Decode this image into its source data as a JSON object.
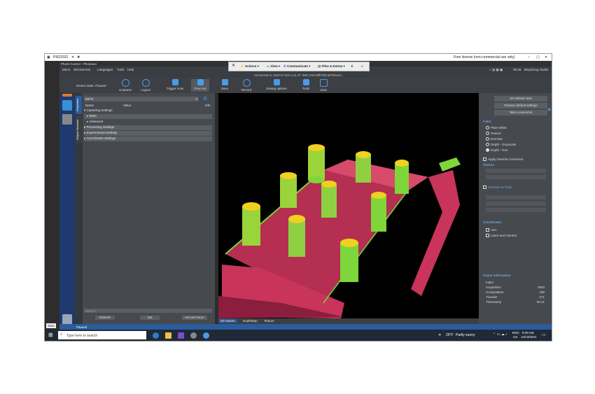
{
  "remote": {
    "session_id": "PI622931",
    "license": "Free license (non-commercial use only)",
    "toolbar": {
      "actions": "Actions",
      "view": "View",
      "communicate": "Communicate",
      "files": "Files & Extras"
    }
  },
  "app": {
    "title": "PhoXi Control - Photoneo",
    "menu": [
      "Menu",
      "3DCameras",
      "Languages",
      "Tools",
      "Help"
    ],
    "connected": "Connected to: 2019-07-021-LC3, IP: fe80::204:4bff:fe05:a078%eno...",
    "device_state": "Device state:  Paused",
    "toolbar": [
      "Unpause",
      "Logout",
      "Trigger scan",
      "Free run",
      "Save",
      "Record",
      "Saving options",
      "Tools",
      "View"
    ],
    "top_right": {
      "time": "09:28",
      "user": "Binpicking Studio"
    }
  },
  "left_tabs": [
    "Properties",
    "Output Structure"
  ],
  "left_panel": {
    "device": "59/70",
    "col_name": "Name",
    "col_value": "Value",
    "col_info": "Info",
    "rows": [
      {
        "label": "Capturing Settings",
        "group": false
      },
      {
        "label": "Basic",
        "group": true
      },
      {
        "label": "Advanced",
        "group": false
      },
      {
        "label": "Processing Settings",
        "group": true
      },
      {
        "label": "Experimental Settings",
        "group": true
      },
      {
        "label": "Coordinates Settings",
        "group": true
      }
    ],
    "search_placeholder": "Search",
    "buttons": [
      "Refresh",
      "Set",
      "Set and Store"
    ]
  },
  "viewer_tabs": [
    "3D Viewer",
    "DepthMap",
    "Texture"
  ],
  "right_panel": {
    "buttons": [
      "Set default view",
      "Restore default settings",
      "Take screenshot"
    ],
    "color_header": "Color",
    "color_options": [
      "Plain White",
      "Texture",
      "Normals",
      "Depth - Grayscale",
      "Depth - Hue"
    ],
    "apply_gamma": "Apply Gamma Correction",
    "texture_header": "Texture",
    "normals_ticks": "Normals as Ticks",
    "coordinates_header": "Coordinates",
    "coord_options": [
      "Axis",
      "Laser and Camera"
    ],
    "frame_header": "Frame information",
    "frame_rows": [
      {
        "label": "Index",
        "value": ""
      },
      {
        "label": "Acquisition",
        "value": "4903"
      },
      {
        "label": "Computation",
        "value": "489"
      },
      {
        "label": "Transfer",
        "value": "271"
      },
      {
        "label": "Timestamp",
        "value": "60.41"
      }
    ]
  },
  "status": "Paused",
  "start_label": "Start",
  "taskbar": {
    "search": "Type here to search",
    "weather_temp": "25°F",
    "weather_text": "Partly sunny",
    "lang": "ENG",
    "region": "US",
    "time": "9:28 AM",
    "date": "12/13/2021"
  },
  "colors": {
    "accent": "#2a5d9c",
    "scene_red": "#d23a5f",
    "scene_green": "#7ed63a",
    "scene_yellow": "#f0d020",
    "highlight": "#6fa7e8"
  }
}
